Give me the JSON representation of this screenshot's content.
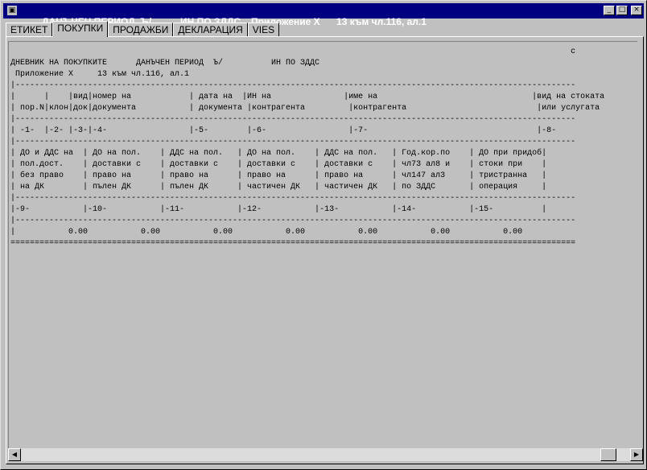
{
  "window": {
    "title_parts": [
      "ДАНЪЧЕН ПЕРИОД  Ъ/",
      "ИН ПО ЗДДС",
      "Приложение X",
      "13 към чл.116, ал.1"
    ]
  },
  "title_buttons": {
    "minimize": "_",
    "maximize": "□",
    "close": "×"
  },
  "tabs": [
    {
      "label": "ЕТИКЕТ",
      "active": false
    },
    {
      "label": "ПОКУПКИ",
      "active": true
    },
    {
      "label": "ПРОДАЖБИ",
      "active": false
    },
    {
      "label": "ДЕКЛАРАЦИЯ",
      "active": false
    },
    {
      "label": "VIES",
      "active": false
    }
  ],
  "report": {
    "lines": [
      "                                                                                                                    с",
      "ДНЕВНИК НА ПОКУПКИТЕ      ДАНЪЧЕН ПЕРИОД  Ъ/          ИН ПО ЗДДС",
      " Приложение X     13 към чл.116, ал.1",
      "|--------------------------------------------------------------------------------------------------------------------",
      "|      |    |вид|номер на            | дата на  |ИН на               |име на                                |вид на стоката",
      "| пор.N|клон|док|документа           | документа |контрагента         |контрагента                           |или услугата",
      "|--------------------------------------------------------------------------------------------------------------------",
      "| -1-  |-2- |-3-|-4-                 |-5-        |-6-                 |-7-                                   |-8-",
      "|--------------------------------------------------------------------------------------------------------------------",
      "| ДО и ДДС на  | ДО на пол.    | ДДС на пол.   | ДО на пол.    | ДДС на пол.   | Год.кор.по    | ДО при придоб|",
      "| пол.дост.    | доставки с    | доставки с    | доставки с    | доставки с    | чл73 ал8 и    | стоки при    |",
      "| без право    | право на      | право на      | право на      | право на      | чл147 ал3     | тристранна   |",
      "| на ДК        | пълен ДК      | пълен ДК      | частичен ДК   | частичен ДК   | по ЗДДС       | операция     |",
      "|--------------------------------------------------------------------------------------------------------------------",
      "|-9-           |-10-           |-11-           |-12-           |-13-           |-14-           |-15-          |",
      "|--------------------------------------------------------------------------------------------------------------------",
      "|           0.00           0.00           0.00           0.00           0.00           0.00           0.00",
      "====================================================================================================================="
    ]
  },
  "scroll": {
    "left_arrow": "◀",
    "right_arrow": "▶"
  }
}
